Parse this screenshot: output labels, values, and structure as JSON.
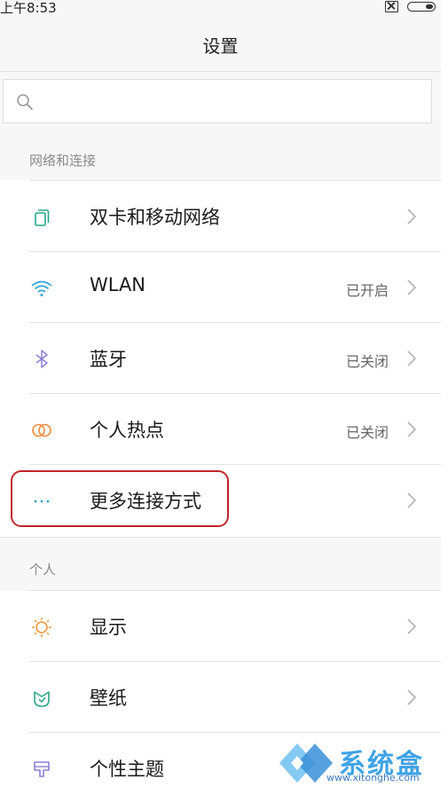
{
  "status_bar": {
    "time": "上午8:53",
    "icons": [
      "sim-icon",
      "battery-icon"
    ]
  },
  "header": {
    "title": "设置"
  },
  "search": {
    "placeholder": ""
  },
  "sections": [
    {
      "label": "网络和连接",
      "items": [
        {
          "label": "双卡和移动网络",
          "value": "",
          "icon": "sim-cards-icon",
          "icon_color": "#2aa68a"
        },
        {
          "label": "WLAN",
          "value": "已开启",
          "icon": "wifi-icon",
          "icon_color": "#2aa4d8"
        },
        {
          "label": "蓝牙",
          "value": "已关闭",
          "icon": "bluetooth-icon",
          "icon_color": "#8d7fd6"
        },
        {
          "label": "个人热点",
          "value": "已关闭",
          "icon": "hotspot-icon",
          "icon_color": "#f08a3c"
        },
        {
          "label": "更多连接方式",
          "value": "",
          "icon": "more-icon",
          "icon_color": "#2a9fc6"
        }
      ]
    },
    {
      "label": "个人",
      "items": [
        {
          "label": "显示",
          "value": "",
          "icon": "sun-icon",
          "icon_color": "#f0963c"
        },
        {
          "label": "壁纸",
          "value": "",
          "icon": "wallpaper-icon",
          "icon_color": "#2aa68a"
        },
        {
          "label": "个性主题",
          "value": "",
          "icon": "theme-icon",
          "icon_color": "#8d7fd6"
        }
      ]
    }
  ],
  "watermark": {
    "text": "系统盒",
    "url": "www.xitonghe.com"
  },
  "colors": {
    "highlight": "#c0262b",
    "chevron": "#b3b3b3"
  }
}
